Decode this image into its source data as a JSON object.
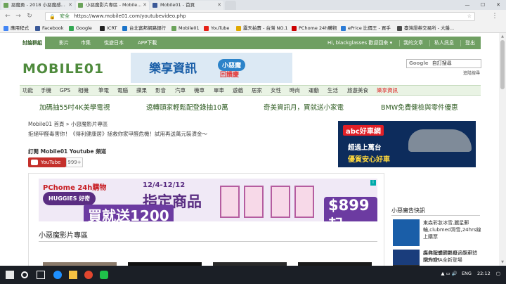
{
  "browser": {
    "tabs": [
      {
        "label": "惡魔勇 - 2018 小惡魔感...",
        "icon_color": "#6ba35a"
      },
      {
        "label": "小惡魔影片專區 - Mobile...",
        "icon_color": "#6ba35a"
      },
      {
        "label": "Mobile01 - 首頁",
        "icon_color": "#3b5998"
      }
    ],
    "window_buttons": [
      "—",
      "☐",
      "✕"
    ],
    "secure_label": "安全",
    "url": "https://www.mobile01.com/youtubevideo.php",
    "bookmarks": [
      {
        "label": "應用程式",
        "color": "#4285f4"
      },
      {
        "label": "Facebook",
        "color": "#3b5998"
      },
      {
        "label": "Google",
        "color": "#34a853"
      },
      {
        "label": "ICRT",
        "color": "#222222"
      },
      {
        "label": "台北富邦網路銀行",
        "color": "#1a73c9"
      },
      {
        "label": "Mobile01",
        "color": "#6ba35a"
      },
      {
        "label": "YouTube",
        "color": "#e62117"
      },
      {
        "label": "露天拍賣 - 台灣 NO.1",
        "color": "#e0a800"
      },
      {
        "label": "PChome 24h購物",
        "color": "#cc0000"
      },
      {
        "label": "ePrice 比價王 - 買手",
        "color": "#2b7bd6"
      },
      {
        "label": "臺灣證券交易所 - 大盤...",
        "color": "#4a4a4a"
      }
    ]
  },
  "site_nav": {
    "items": [
      "討論群組",
      "影片",
      "市集",
      "悅遊日本",
      "APP下載"
    ],
    "user_greeting": "Hi, blackglasses 歡迎回來 ▾",
    "my_articles": "我的文章",
    "private_message": "私人訊息",
    "logout": "登出"
  },
  "header": {
    "logo_text": "MOBILE01",
    "banner_main": "樂享資訊",
    "banner_badge": "小惡魔",
    "banner_sub": "回饋慶",
    "search_brand": "Google",
    "search_placeholder": "自訂搜尋",
    "advanced_search": "進階搜尋"
  },
  "categories": [
    {
      "label": "功能",
      "hl": false
    },
    {
      "label": "手機",
      "hl": false
    },
    {
      "label": "GPS",
      "hl": false
    },
    {
      "label": "相機",
      "hl": false
    },
    {
      "label": "筆電",
      "hl": false
    },
    {
      "label": "電腦",
      "hl": false
    },
    {
      "label": "蘋果",
      "hl": false
    },
    {
      "label": "影音",
      "hl": false
    },
    {
      "label": "汽車",
      "hl": false
    },
    {
      "label": "機車",
      "hl": false
    },
    {
      "label": "單車",
      "hl": false
    },
    {
      "label": "遊戲",
      "hl": false
    },
    {
      "label": "居家",
      "hl": false
    },
    {
      "label": "女性",
      "hl": false
    },
    {
      "label": "時尚",
      "hl": false
    },
    {
      "label": "運動",
      "hl": false
    },
    {
      "label": "生活",
      "hl": false
    },
    {
      "label": "旅遊美食",
      "hl": false
    },
    {
      "label": "樂享資訊",
      "hl": true
    }
  ],
  "promos": [
    "加碼抽55吋4K美學電視",
    "遶轉頭家輕鬆配登錄抽10萬",
    "奇美資訊月，買就送小家電",
    "BMW免費健檢與零件優惠"
  ],
  "main": {
    "breadcrumb": "Mobile01 首頁 » 小惡魔影片專區",
    "notice": "拒絕甲醛毒害你！《得利健康居》拯救你家甲醛危機！試用再送萬元裝潢金～",
    "subscribe_title": "訂閱 Mobile01 Youtube 頻道",
    "youtube_label": "YouTube",
    "subscriber_count": "999+",
    "section_title": "小惡魔影片專區"
  },
  "ad_right": {
    "brand": "abc好車網",
    "line1": "超過上萬台",
    "line2": "優質安心好車"
  },
  "ad_main": {
    "store": "PChome 24h購物",
    "brand": "HUGGIES 好奇",
    "dates": "12/4-12/12",
    "headline": "指定商品",
    "offer": "買就送1200",
    "price": "$899起"
  },
  "sidebar": {
    "title": "小惡魔告快訊",
    "items": [
      {
        "text": "東森彩妝冰雪,麗星郵輪,clubmed滑雪,24hrs線上購票",
        "color": "#1a5ea8"
      },
      {
        "text": "為你設想的新舒適原車SENTRA全新登場",
        "color": "#2a2a2a"
      },
      {
        "text": "經典配備更熱血，Golf錯購升級！",
        "color": "#1a3d7c"
      }
    ]
  },
  "taskbar": {
    "lang": "ENG",
    "time": "22:12"
  }
}
